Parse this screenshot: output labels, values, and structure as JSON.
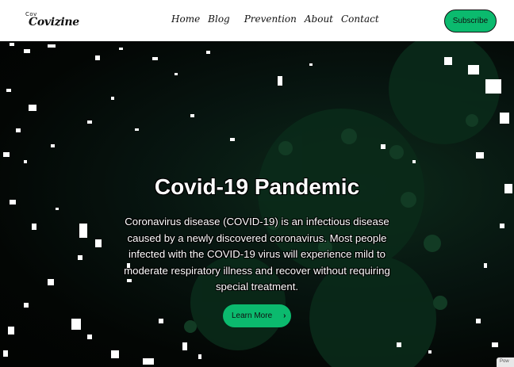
{
  "header": {
    "logo_small": "Cov",
    "logo_main": "Covizine",
    "nav": [
      "Home",
      "Blog",
      "Prevention",
      "About",
      "Contact"
    ],
    "subscribe_label": "Subscribe"
  },
  "hero": {
    "title": "Covid-19 Pandemic",
    "description": "Coronavirus disease (COVID-19) is an infectious disease caused by a newly discovered coronavirus. Most people infected with the COVID-19 virus will experience mild to moderate respiratory illness and recover without requiring special treatment.",
    "cta_label": "Learn More",
    "cta_icon": "chevron-right-icon"
  },
  "corner_badge": "Pow",
  "colors": {
    "accent": "#0bba6e",
    "header_bg": "#ffffff",
    "hero_bg": "#050705"
  }
}
